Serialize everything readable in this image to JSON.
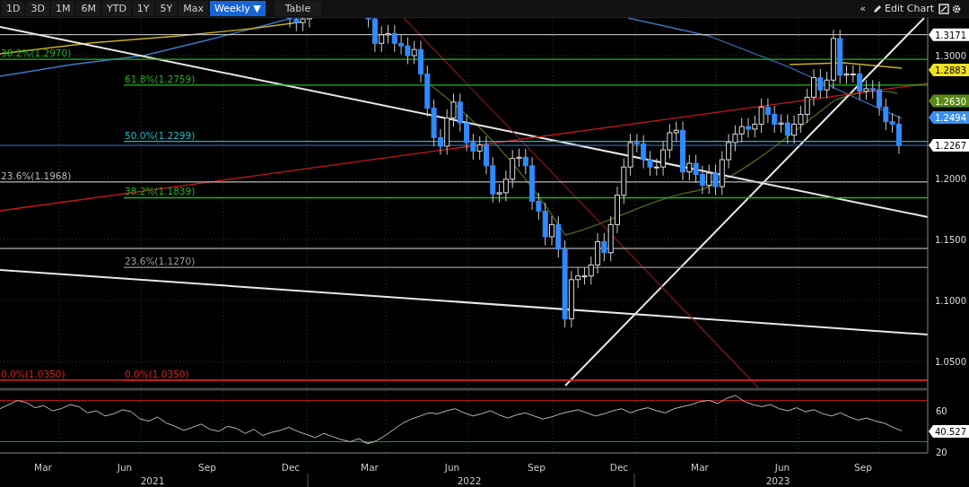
{
  "toolbar": {
    "periods": [
      {
        "label": "1D",
        "selected": false
      },
      {
        "label": "3D",
        "selected": false
      },
      {
        "label": "1M",
        "selected": false
      },
      {
        "label": "6M",
        "selected": false
      },
      {
        "label": "YTD",
        "selected": false
      },
      {
        "label": "1Y",
        "selected": false
      },
      {
        "label": "5Y",
        "selected": false
      },
      {
        "label": "Max",
        "selected": false
      },
      {
        "label": "Weekly ▼",
        "selected": true
      }
    ],
    "table_button": "Table",
    "collapse_button": "«",
    "edit_chart_button": "Edit Chart"
  },
  "price_chart": {
    "axis_labels": [
      "1.3000",
      "1.2000",
      "1.1500",
      "1.1000",
      "1.0500"
    ],
    "fib_levels": [
      {
        "label": "38.2%(1.2970)",
        "color": "#1fb51f"
      },
      {
        "label": "61.8%(1.2759)",
        "color": "#1fb51f"
      },
      {
        "label": "50.0%(1.2299)",
        "color": "#20b8c0"
      },
      {
        "label": "23.6%(1.1968)",
        "color": "#b8b8b8"
      },
      {
        "label": "38.2%(1.1839)",
        "color": "#1fb51f"
      },
      {
        "label": "23.6%(1.1270)",
        "color": "#9a9a9a"
      },
      {
        "label": "0.0%(1.0350)",
        "color": "#e02020"
      },
      {
        "label": "0.0%(1.0350)",
        "color": "#e02020"
      }
    ],
    "price_tags": [
      {
        "label": "1.3171",
        "color": "#ffffff"
      },
      {
        "label": "1.2883",
        "color": "#f0e020"
      },
      {
        "label": "1.2630",
        "color": "#5a8a10"
      },
      {
        "label": "1.2494",
        "color": "#3a90f0"
      },
      {
        "label": "1.2267",
        "color": "#ffffff"
      }
    ]
  },
  "rsi_panel": {
    "axis_labels": [
      "60",
      "20"
    ],
    "value_tag": "40.527"
  },
  "time_axis": {
    "months": [
      "Mar",
      "Jun",
      "Sep",
      "Dec",
      "Mar",
      "Jun",
      "Sep",
      "Dec",
      "Mar",
      "Jun",
      "Sep"
    ],
    "years": [
      "2021",
      "2022",
      "2023"
    ]
  }
}
